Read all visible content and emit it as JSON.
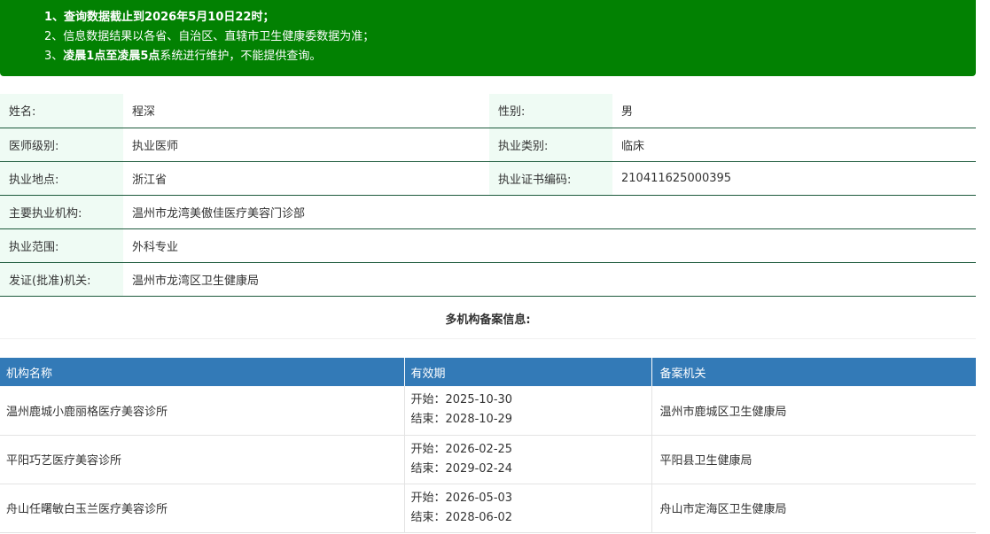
{
  "notice": {
    "line1": "1、查询数据截止到2026年5月10日22时；",
    "line2": "2、信息数据结果以各省、自治区、直辖市卫生健康委数据为准；",
    "line3_prefix": "3、",
    "line3_bold": "凌晨1点至凌晨5点",
    "line3_suffix": "系统进行维护，不能提供查询。"
  },
  "info": {
    "name_label": "姓名:",
    "name_value": "程深",
    "gender_label": "性别:",
    "gender_value": "男",
    "level_label": "医师级别:",
    "level_value": "执业医师",
    "category_label": "执业类别:",
    "category_value": "临床",
    "location_label": "执业地点:",
    "location_value": "浙江省",
    "cert_label": "执业证书编码:",
    "cert_value": "210411625000395",
    "org_label": "主要执业机构:",
    "org_value": "温州市龙湾美傲佳医疗美容门诊部",
    "scope_label": "执业范围:",
    "scope_value": "外科专业",
    "authority_label": "发证(批准)机关:",
    "authority_value": "温州市龙湾区卫生健康局"
  },
  "multi": {
    "title": "多机构备案信息:",
    "headers": {
      "org": "机构名称",
      "period": "有效期",
      "authority": "备案机关"
    },
    "rows": [
      {
        "org": "温州鹿城小鹿丽格医疗美容诊所",
        "start": "开始：2025-10-30",
        "end": "结束：2028-10-29",
        "authority": "温州市鹿城区卫生健康局"
      },
      {
        "org": "平阳巧艺医疗美容诊所",
        "start": "开始：2026-02-25",
        "end": "结束：2029-02-24",
        "authority": "平阳县卫生健康局"
      },
      {
        "org": "舟山任曙敏白玉兰医疗美容诊所",
        "start": "开始：2026-05-03",
        "end": "结束：2028-06-02",
        "authority": "舟山市定海区卫生健康局"
      }
    ]
  }
}
